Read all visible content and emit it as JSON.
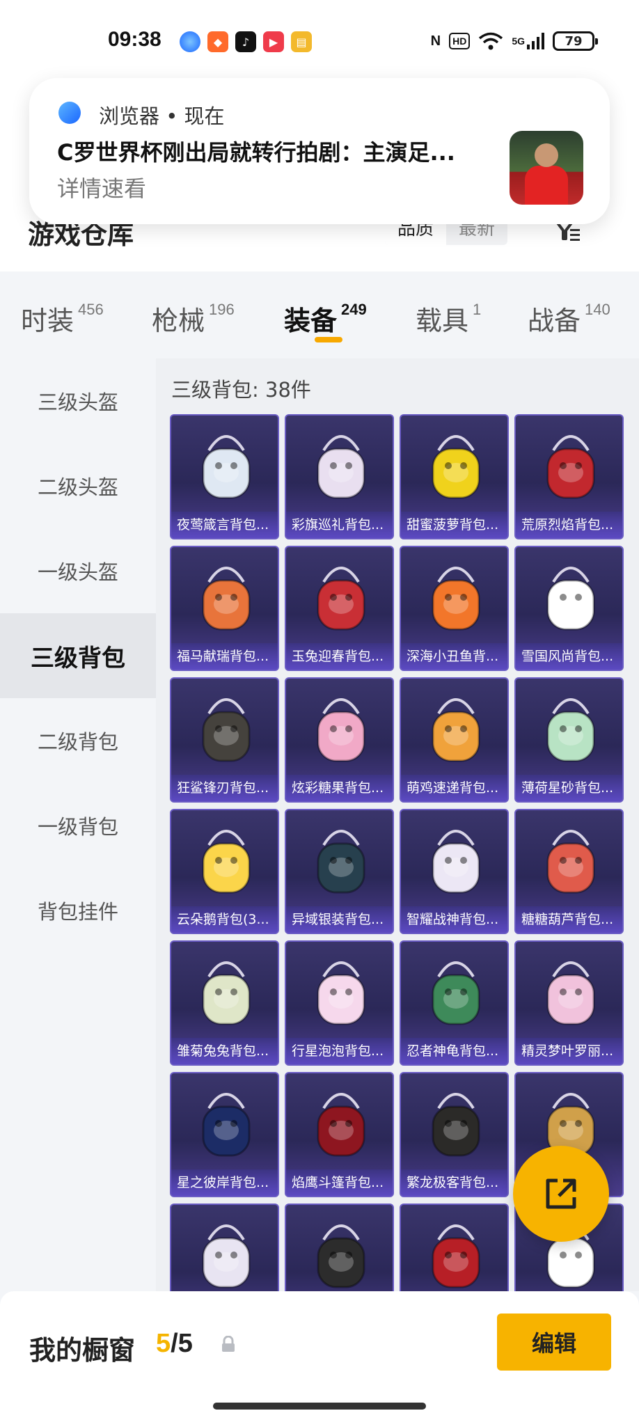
{
  "status_bar": {
    "time": "09:38",
    "network": "5G",
    "hd": "HD",
    "battery": "79"
  },
  "notification": {
    "source": "浏览器 • 现在",
    "title": "C罗世界杯刚出局就转行拍剧：主演足...",
    "subtitle": "详情速看"
  },
  "header": {
    "title": "游戏仓库",
    "sort_options": [
      "品质",
      "最新"
    ]
  },
  "tabs": [
    {
      "label": "时装",
      "count": "456"
    },
    {
      "label": "枪械",
      "count": "196"
    },
    {
      "label": "装备",
      "count": "249"
    },
    {
      "label": "载具",
      "count": "1"
    },
    {
      "label": "战备",
      "count": "140"
    }
  ],
  "sidebar": {
    "items": [
      "三级头盔",
      "二级头盔",
      "一级头盔",
      "三级背包",
      "二级背包",
      "一级背包",
      "背包挂件"
    ],
    "active_index": 3
  },
  "content": {
    "heading": "三级背包: 38件",
    "items": [
      {
        "name": "夜莺箴言背包...",
        "icon": "jellyfish-backpack-icon",
        "color": "#dfe8f3"
      },
      {
        "name": "彩旗巡礼背包...",
        "icon": "bunny-backpack-icon",
        "color": "#e9dff0"
      },
      {
        "name": "甜蜜菠萝背包...",
        "icon": "pineapple-backpack-icon",
        "color": "#f0d21c"
      },
      {
        "name": "荒原烈焰背包...",
        "icon": "flame-backpack-icon",
        "color": "#c2282e"
      },
      {
        "name": "福马献瑞背包...",
        "icon": "horse-backpack-icon",
        "color": "#e8743b"
      },
      {
        "name": "玉兔迎春背包...",
        "icon": "rabbit-backpack-icon",
        "color": "#c92f35"
      },
      {
        "name": "深海小丑鱼背...",
        "icon": "clownfish-backpack-icon",
        "color": "#f2762a"
      },
      {
        "name": "雪国风尚背包...",
        "icon": "penguin-backpack-icon",
        "color": "#ffffff"
      },
      {
        "name": "狂鲨锋刃背包...",
        "icon": "shark-backpack-icon",
        "color": "#45423d"
      },
      {
        "name": "炫彩糖果背包...",
        "icon": "donut-backpack-icon",
        "color": "#f1a9c7"
      },
      {
        "name": "萌鸡速递背包...",
        "icon": "chick-backpack-icon",
        "color": "#f0a23b"
      },
      {
        "name": "薄荷星砂背包...",
        "icon": "mint-backpack-icon",
        "color": "#b8e3c4"
      },
      {
        "name": "云朵鹅背包(3...",
        "icon": "goose-backpack-icon",
        "color": "#fbd54a"
      },
      {
        "name": "异域银装背包...",
        "icon": "tech-backpack-icon",
        "color": "#27404e"
      },
      {
        "name": "智耀战神背包...",
        "icon": "warrior-backpack-icon",
        "color": "#ece7f5"
      },
      {
        "name": "糖糖葫芦背包...",
        "icon": "gourd-backpack-icon",
        "color": "#e05b4b"
      },
      {
        "name": "雏菊兔兔背包...",
        "icon": "daisy-backpack-icon",
        "color": "#dfe6c8"
      },
      {
        "name": "行星泡泡背包...",
        "icon": "bubble-backpack-icon",
        "color": "#f6d8ec"
      },
      {
        "name": "忍者神龟背包...",
        "icon": "turtle-backpack-icon",
        "color": "#3e8a5a"
      },
      {
        "name": "精灵梦叶罗丽...",
        "icon": "heart-backpack-icon",
        "color": "#f1c2dc"
      },
      {
        "name": "星之彼岸背包...",
        "icon": "astronaut-backpack-icon",
        "color": "#1c2c66"
      },
      {
        "name": "焰鹰斗篷背包...",
        "icon": "cape-backpack-icon",
        "color": "#8e1620"
      },
      {
        "name": "繁龙极客背包...",
        "icon": "dragon-backpack-icon",
        "color": "#2b2a28"
      },
      {
        "name": "",
        "icon": "scroll-backpack-icon",
        "color": "#d0a04a"
      },
      {
        "name": "",
        "icon": "spirit-backpack-icon",
        "color": "#e8e4f2"
      },
      {
        "name": "",
        "icon": "peace-backpack-icon",
        "color": "#2c2c2c"
      },
      {
        "name": "",
        "icon": "red-backpack-icon",
        "color": "#b71f26"
      },
      {
        "name": "",
        "icon": "cow-backpack-icon",
        "color": "#ffffff"
      }
    ]
  },
  "bottom_bar": {
    "label": "我的橱窗",
    "current": "5",
    "separator": "/",
    "max": "5",
    "edit_label": "编辑"
  },
  "colors": {
    "accent": "#f7b300",
    "card_bg": "#2b2858",
    "card_label": "#5c4ac4"
  }
}
